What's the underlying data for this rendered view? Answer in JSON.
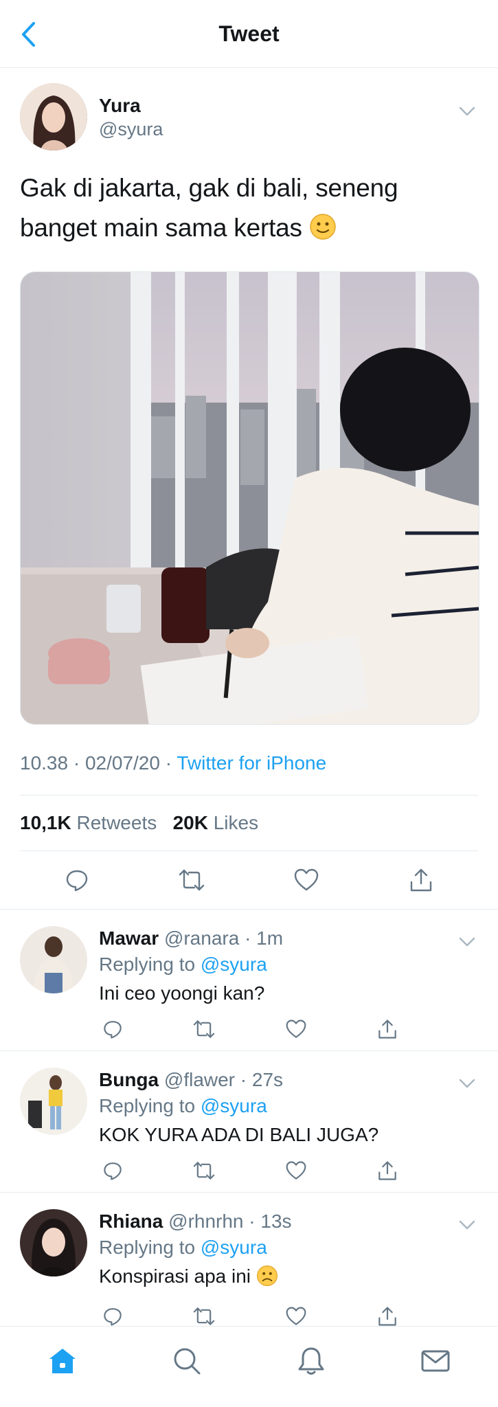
{
  "header": {
    "title": "Tweet",
    "back_icon": "chevron-left-icon"
  },
  "tweet": {
    "author": {
      "name": "Yura",
      "handle": "@syura"
    },
    "text": "Gak di jakarta, gak di bali, seneng banget main sama kertas",
    "emoji": "slightly-smiling-face-emoji",
    "meta": {
      "time_date": "10.38 · 02/07/20 · ",
      "client": "Twitter for iPhone"
    },
    "stats": {
      "retweets_count": "10,1K",
      "retweets_label": "Retweets",
      "likes_count": "20K",
      "likes_label": "Likes"
    }
  },
  "replies": [
    {
      "name": "Mawar",
      "meta": "@ranara · 1m",
      "replying_prefix": "Replying to ",
      "replying_to": "@syura",
      "text": "Ini ceo yoongi kan?"
    },
    {
      "name": "Bunga",
      "meta": "@flawer · 27s",
      "replying_prefix": "Replying to ",
      "replying_to": "@syura",
      "text": "KOK YURA ADA DI BALI JUGA?"
    },
    {
      "name": "Rhiana",
      "meta": "@rhnrhn · 13s",
      "replying_prefix": "Replying to ",
      "replying_to": "@syura",
      "text": "Konspirasi apa ini"
    }
  ],
  "tabbar": [
    "home-icon",
    "search-icon",
    "notifications-bell-icon",
    "messages-envelope-icon"
  ],
  "colors": {
    "accent": "#1da1f2",
    "muted": "#657786",
    "text": "#14171a",
    "divider": "#e6ecf0"
  }
}
